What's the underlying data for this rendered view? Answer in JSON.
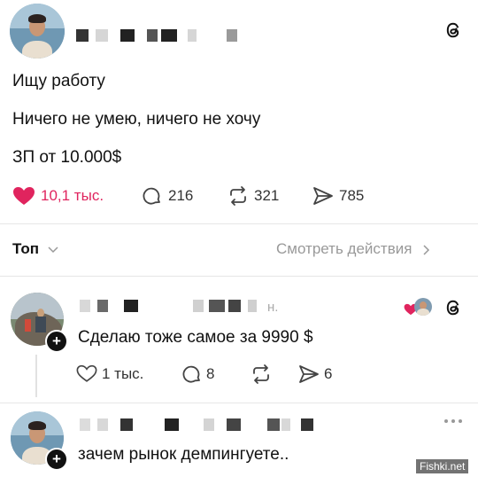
{
  "post": {
    "lines": [
      "Ищу работу",
      "Ничего не умею, ничего не хочу",
      "ЗП от 10.000$"
    ],
    "stats": {
      "likes": "10,1 тыс.",
      "comments": "216",
      "reposts": "321",
      "shares": "785"
    }
  },
  "sort": {
    "label": "Топ",
    "view_activity": "Смотреть действия"
  },
  "replies": [
    {
      "time_suffix": "н.",
      "text": "Сделаю тоже самое за 9990 $",
      "stats": {
        "likes": "1 тыс.",
        "comments": "8",
        "shares": "6"
      }
    },
    {
      "text": "зачем рынок демпингуете.."
    }
  ],
  "watermark": "Fishki.net",
  "colors": {
    "like_red": "#e0245e",
    "text": "#111111",
    "muted": "#999999"
  },
  "icons": [
    "threads-icon",
    "heart-icon",
    "comment-icon",
    "repost-icon",
    "share-icon",
    "chevron-down-icon",
    "chevron-right-icon",
    "more-icon",
    "plus-icon"
  ]
}
